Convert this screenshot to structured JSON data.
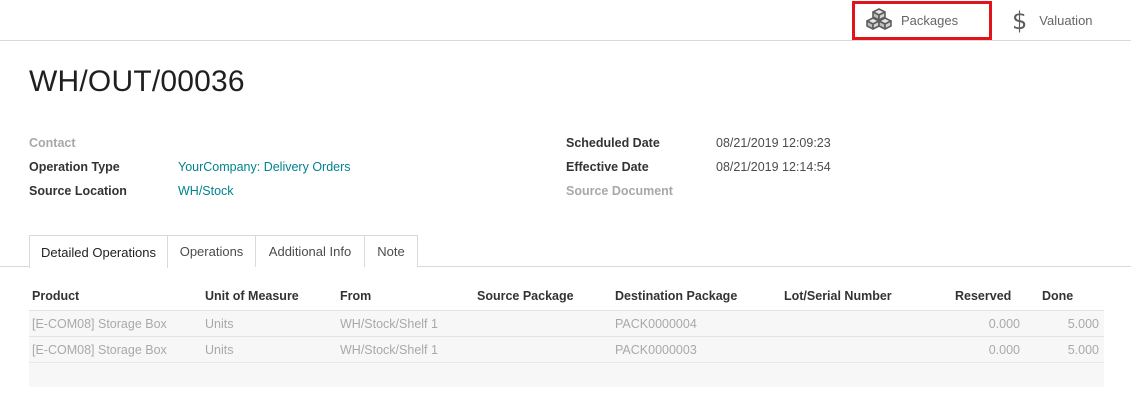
{
  "smart_buttons": {
    "packages_label": "Packages",
    "packages_icon": "cubes-icon",
    "valuation_label": "Valuation",
    "valuation_symbol": "$",
    "highlight_color": "#e3131b"
  },
  "record": {
    "title": "WH/OUT/00036"
  },
  "fields_left": {
    "contact_label": "Contact",
    "contact_value": "",
    "operation_type_label": "Operation Type",
    "operation_type_value": "YourCompany: Delivery Orders",
    "source_location_label": "Source Location",
    "source_location_value": "WH/Stock"
  },
  "fields_right": {
    "scheduled_date_label": "Scheduled Date",
    "scheduled_date_value": "08/21/2019 12:09:23",
    "effective_date_label": "Effective Date",
    "effective_date_value": "08/21/2019 12:14:54",
    "source_document_label": "Source Document",
    "source_document_value": ""
  },
  "tabs": [
    {
      "label": "Detailed Operations",
      "active": true
    },
    {
      "label": "Operations",
      "active": false
    },
    {
      "label": "Additional Info",
      "active": false
    },
    {
      "label": "Note",
      "active": false
    }
  ],
  "table": {
    "columns": [
      "Product",
      "Unit of Measure",
      "From",
      "Source Package",
      "Destination Package",
      "Lot/Serial Number",
      "Reserved",
      "Done"
    ],
    "rows": [
      {
        "product": "[E-COM08] Storage Box",
        "uom": "Units",
        "from": "WH/Stock/Shelf 1",
        "source_package": "",
        "destination_package": "PACK0000004",
        "lot": "",
        "reserved": "0.000",
        "done": "5.000"
      },
      {
        "product": "[E-COM08] Storage Box",
        "uom": "Units",
        "from": "WH/Stock/Shelf 1",
        "source_package": "",
        "destination_package": "PACK0000003",
        "lot": "",
        "reserved": "0.000",
        "done": "5.000"
      }
    ]
  },
  "colors": {
    "link": "#00838f",
    "muted_label": "#a8a8a8",
    "row_background": "#f7f7f7"
  }
}
